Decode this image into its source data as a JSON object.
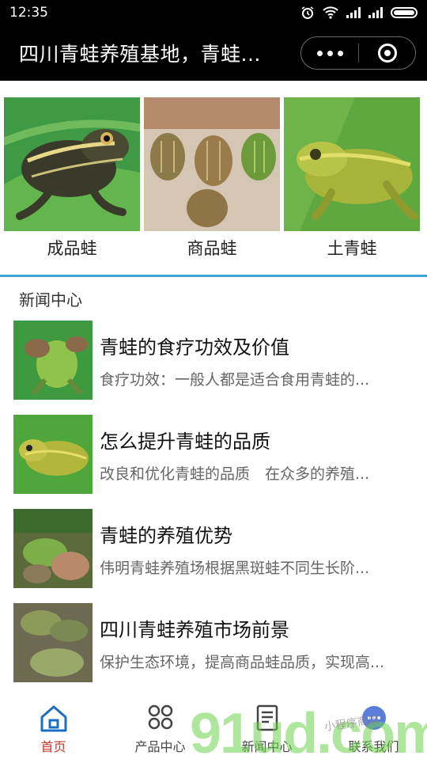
{
  "status_bar": {
    "time": "12:35"
  },
  "nav": {
    "title": "四川青蛙养殖基地，青蛙..."
  },
  "products": [
    {
      "label": "成品蛙",
      "icon": "frog-photo-adult"
    },
    {
      "label": "商品蛙",
      "icon": "frog-photo-group"
    },
    {
      "label": "土青蛙",
      "icon": "frog-photo-native"
    }
  ],
  "news": {
    "header": "新闻中心",
    "items": [
      {
        "title": "青蛙的食疗功效及价值",
        "summary": "食疗功效：一般人都是适合食用青蛙的..."
      },
      {
        "title": "怎么提升青蛙的品质",
        "summary": "改良和优化青蛙的品质　在众多的养殖..."
      },
      {
        "title": "青蛙的养殖优势",
        "summary": "伟明青蛙养殖场根据黑斑蛙不同生长阶..."
      },
      {
        "title": "四川青蛙养殖市场前景",
        "summary": "保护生态环境，提高商品蛙品质，实现高..."
      }
    ]
  },
  "tabs": [
    {
      "label": "首页",
      "icon": "home-icon",
      "active": true
    },
    {
      "label": "产品中心",
      "icon": "grid-icon",
      "active": false
    },
    {
      "label": "新闻中心",
      "icon": "document-icon",
      "active": false
    },
    {
      "label": "联系我们",
      "icon": "chat-icon",
      "active": false
    }
  ],
  "colors": {
    "accent": "#3ea7d8",
    "active_tab": "#c0392b",
    "nav_bg": "#000000"
  },
  "watermark": {
    "text": "91ud.com",
    "caption": "小程序商店"
  }
}
